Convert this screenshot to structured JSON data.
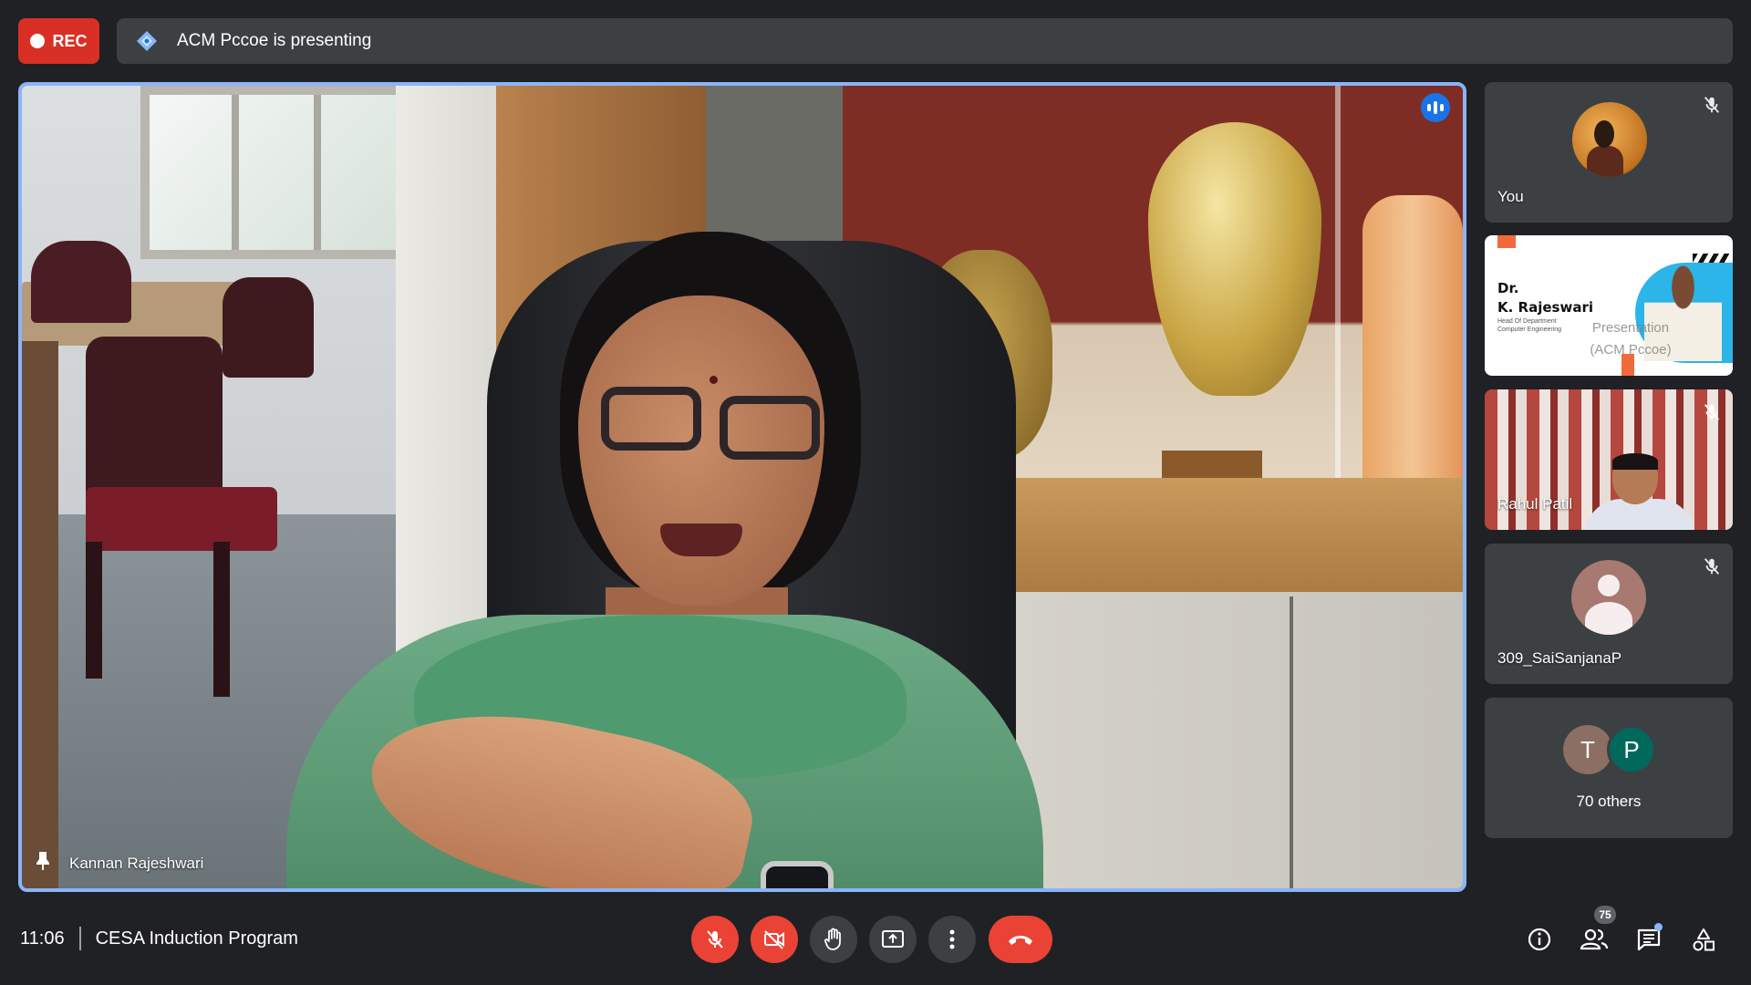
{
  "recording": {
    "label": "REC",
    "color": "#d93025"
  },
  "presenting": {
    "text": "ACM Pccoe is presenting",
    "icon": "present-diamond-icon"
  },
  "main_video": {
    "speaker_name": "Kannan Rajeshwari",
    "speaking": true,
    "pin_icon": "pin-icon",
    "highlight_color": "#8ab4f8"
  },
  "side_tiles": {
    "self": {
      "name": "You",
      "muted": true
    },
    "presentation": {
      "title_line1": "Dr.",
      "title_line2": "K. Rajeswari",
      "subtitle_line1": "Head Of Department",
      "subtitle_line2": "Computer Engineering",
      "overlay_line1": "Presentation",
      "overlay_line2": "(ACM Pccoe)"
    },
    "rahul": {
      "name": "Rahul Patil",
      "muted": true
    },
    "sai": {
      "name": "309_SaiSanjanaP",
      "muted": true
    },
    "others": {
      "initial1": "T",
      "initial2": "P",
      "label": "70 others"
    }
  },
  "bottom_bar": {
    "time": "11:06",
    "meeting_title": "CESA Induction Program",
    "controls": [
      {
        "name": "mic-off",
        "state": "off"
      },
      {
        "name": "camera-off",
        "state": "off"
      },
      {
        "name": "raise-hand"
      },
      {
        "name": "present-now"
      },
      {
        "name": "more-options"
      },
      {
        "name": "leave-call"
      }
    ],
    "participants_count": "75",
    "chat_unread": true
  },
  "colors": {
    "background": "#202124",
    "tile": "#3c4043",
    "red": "#ea4335",
    "accent_blue": "#1a73e8"
  }
}
